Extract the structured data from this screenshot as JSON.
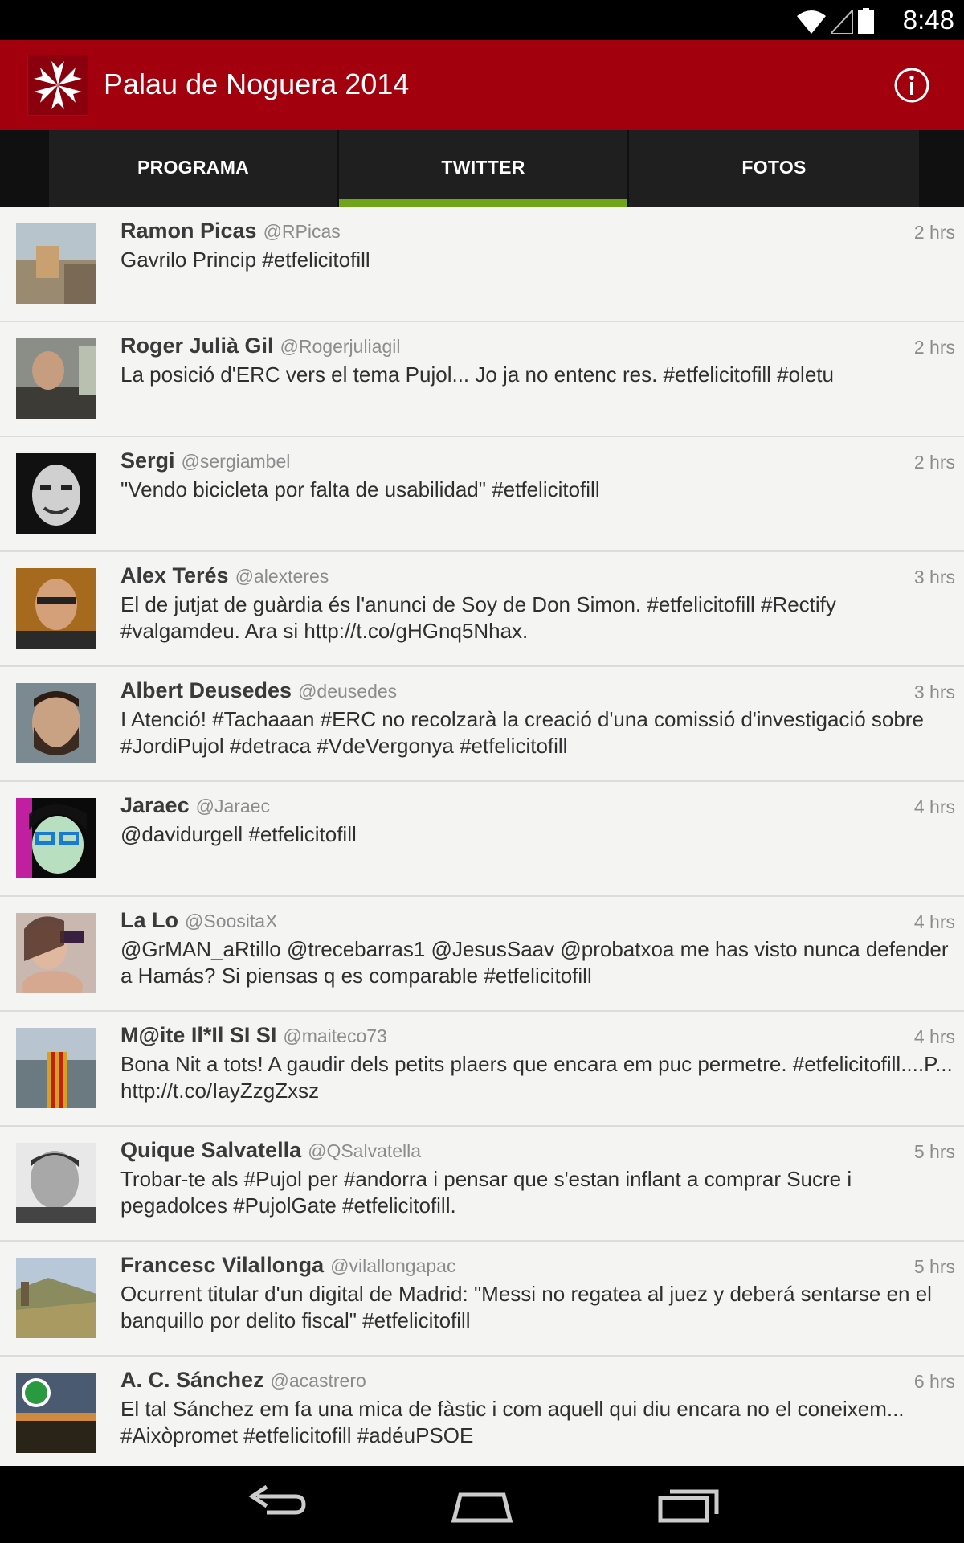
{
  "status_bar": {
    "time": "8:48",
    "icons": [
      "wifi-icon",
      "signal-icon",
      "battery-icon"
    ]
  },
  "action_bar": {
    "title": "Palau de Noguera 2014",
    "logo_icon": "maltese-cross-icon",
    "info_icon": "info-icon",
    "background": "#a3000e"
  },
  "tabs": [
    {
      "label": "PROGRAMA",
      "selected": false
    },
    {
      "label": "TWITTER",
      "selected": true
    },
    {
      "label": "FOTOS",
      "selected": false
    }
  ],
  "accent_color": "#6fa516",
  "tweets": [
    {
      "name": "Ramon Picas",
      "handle": "@RPicas",
      "time": "2 hrs",
      "text": "Gavrilo Princip #etfelicitofill"
    },
    {
      "name": "Roger Julià Gil",
      "handle": "@Rogerjuliagil",
      "time": "2 hrs",
      "text": "La posició d'ERC vers el tema Pujol... Jo ja no entenc res. #etfelicitofill #oletu"
    },
    {
      "name": "Sergi",
      "handle": "@sergiambel",
      "time": "2 hrs",
      "text": "\"Vendo bicicleta por falta de usabilidad\" #etfelicitofill"
    },
    {
      "name": "Alex Terés",
      "handle": "@alexteres",
      "time": "3 hrs",
      "text": "El de jutjat de guàrdia és l'anunci de Soy de Don Simon. #etfelicitofill #Rectify #valgamdeu. Ara si http://t.co/gHGnq5Nhax."
    },
    {
      "name": "Albert Deusedes",
      "handle": "@deusedes",
      "time": "3 hrs",
      "text": "I Atenció! #Tachaaan #ERC no recolzarà la creació d'una comissió d'investigació sobre #JordiPujol #detraca #VdeVergonya #etfelicitofill"
    },
    {
      "name": "Jaraec",
      "handle": "@Jaraec",
      "time": "4 hrs",
      "text": "@davidurgell #etfelicitofill"
    },
    {
      "name": "La Lo",
      "handle": "@SoositaX",
      "time": "4 hrs",
      "text": "@GrMAN_aRtillo @trecebarras1 @JesusSaav @probatxoa me has visto nunca defender a Hamás? Si piensas q es comparable #etfelicitofill"
    },
    {
      "name": "M@ite Il*Il SI SI",
      "handle": "@maiteco73",
      "time": "4 hrs",
      "text": "Bona Nit a tots! A gaudir dels petits plaers que encara em puc permetre. #etfelicitofill....P... http://t.co/IayZzgZxsz"
    },
    {
      "name": "Quique Salvatella",
      "handle": "@QSalvatella",
      "time": "5 hrs",
      "text": "Trobar-te als #Pujol per #andorra i pensar que s'estan inflant a comprar Sucre i pegadolces #PujolGate #etfelicitofill."
    },
    {
      "name": "Francesc Vilallonga",
      "handle": "@vilallongapac",
      "time": "5 hrs",
      "text": "Ocurrent titular d'un digital de Madrid: \"Messi no regatea al juez y deberá sentarse en el banquillo por delito fiscal\" #etfelicitofill"
    },
    {
      "name": "A. C. Sánchez",
      "handle": "@acastrero",
      "time": "6 hrs",
      "text": "El tal Sánchez em fa una mica de fàstic i com aquell qui diu encara no el coneixem... #Aixòpromet #etfelicitofill #adéuPSOE"
    }
  ],
  "nav_bar": {
    "icons": [
      "back-icon",
      "home-icon",
      "recents-icon"
    ]
  }
}
